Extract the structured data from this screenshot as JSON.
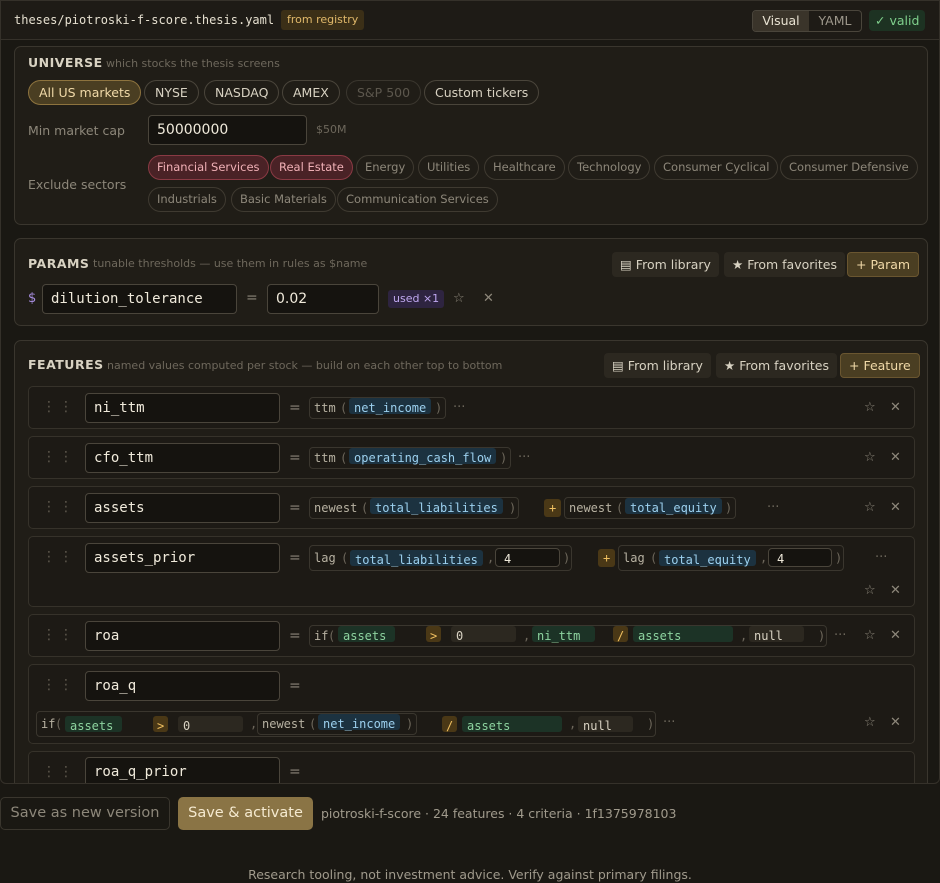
{
  "header": {
    "file_path": "theses/piotroski-f-score.thesis.yaml",
    "registry_badge": "from registry",
    "tab_visual": "Visual",
    "tab_yaml": "YAML",
    "valid_badge": "✓ valid"
  },
  "universe": {
    "title": "UNIVERSE",
    "subtitle": "which stocks the thesis screens",
    "markets": [
      "All US markets",
      "NYSE",
      "NASDAQ",
      "AMEX",
      "S&P 500",
      "Custom tickers"
    ],
    "selected_market": "All US markets",
    "disabled_market": "S&P 500",
    "min_cap_label": "Min market cap",
    "min_cap_value": "50000000",
    "min_cap_hint": "$50M",
    "exclude_label": "Exclude sectors",
    "sectors": [
      "Financial Services",
      "Real Estate",
      "Energy",
      "Utilities",
      "Healthcare",
      "Technology",
      "Consumer Cyclical",
      "Consumer Defensive",
      "Industrials",
      "Basic Materials",
      "Communication Services"
    ],
    "excluded_sectors": [
      "Financial Services",
      "Real Estate"
    ]
  },
  "params": {
    "title": "PARAMS",
    "subtitle": "tunable thresholds — use them in rules as $name",
    "from_library": "From library",
    "from_favorites": "From favorites",
    "add": "+ Param",
    "items": [
      {
        "prefix": "$",
        "name": "dilution_tolerance",
        "eq": "=",
        "value": "0.02",
        "used": "used ×1"
      }
    ]
  },
  "features": {
    "title": "FEATURES",
    "subtitle": "named values computed per stock — build on each other top to bottom",
    "from_library": "From library",
    "from_favorites": "From favorites",
    "add": "+ Feature",
    "eq": "=",
    "items": [
      {
        "name": "ni_ttm",
        "fn": "ttm",
        "arg": "net_income"
      },
      {
        "name": "cfo_ttm",
        "fn": "ttm",
        "arg": "operating_cash_flow"
      },
      {
        "name": "assets",
        "fn1": "newest",
        "arg1": "total_liabilities",
        "op": "+",
        "fn2": "newest",
        "arg2": "total_equity"
      },
      {
        "name": "assets_prior",
        "fn1": "lag",
        "arg1": "total_liabilities",
        "n1": "4",
        "op": "+",
        "fn2": "lag",
        "arg2": "total_equity",
        "n2": "4"
      },
      {
        "name": "roa",
        "fn": "if",
        "cond_left": "assets",
        "cond_op": ">",
        "cond_right": "0",
        "num": "ni_ttm",
        "div": "/",
        "den": "assets",
        "else": "null"
      },
      {
        "name": "roa_q",
        "fn": "if",
        "cond_left": "assets",
        "cond_op": ">",
        "cond_right": "0",
        "inner_fn": "newest",
        "inner_arg": "net_income",
        "div": "/",
        "den": "assets",
        "else": "null"
      },
      {
        "name": "roa_q_prior"
      }
    ]
  },
  "footer": {
    "save_new": "Save as new version",
    "save_activate": "Save & activate",
    "status": "piotroski-f-score · 24 features · 4 criteria · 1f1375978103",
    "disclaimer": "Research tooling, not investment advice. Verify against primary filings."
  },
  "symbols": {
    "paren_open": "(",
    "paren_close": ")",
    "comma": ",",
    "more": "···",
    "drag": "⋮⋮",
    "star": "☆",
    "close": "✕"
  },
  "colors": {
    "accent": "#8a7445",
    "valid": "#7fcf8c",
    "excluded": "#f0b0b6",
    "field_token": "#9cd0ee",
    "feature_token": "#8ed4a0",
    "operator": "#f0c060"
  }
}
